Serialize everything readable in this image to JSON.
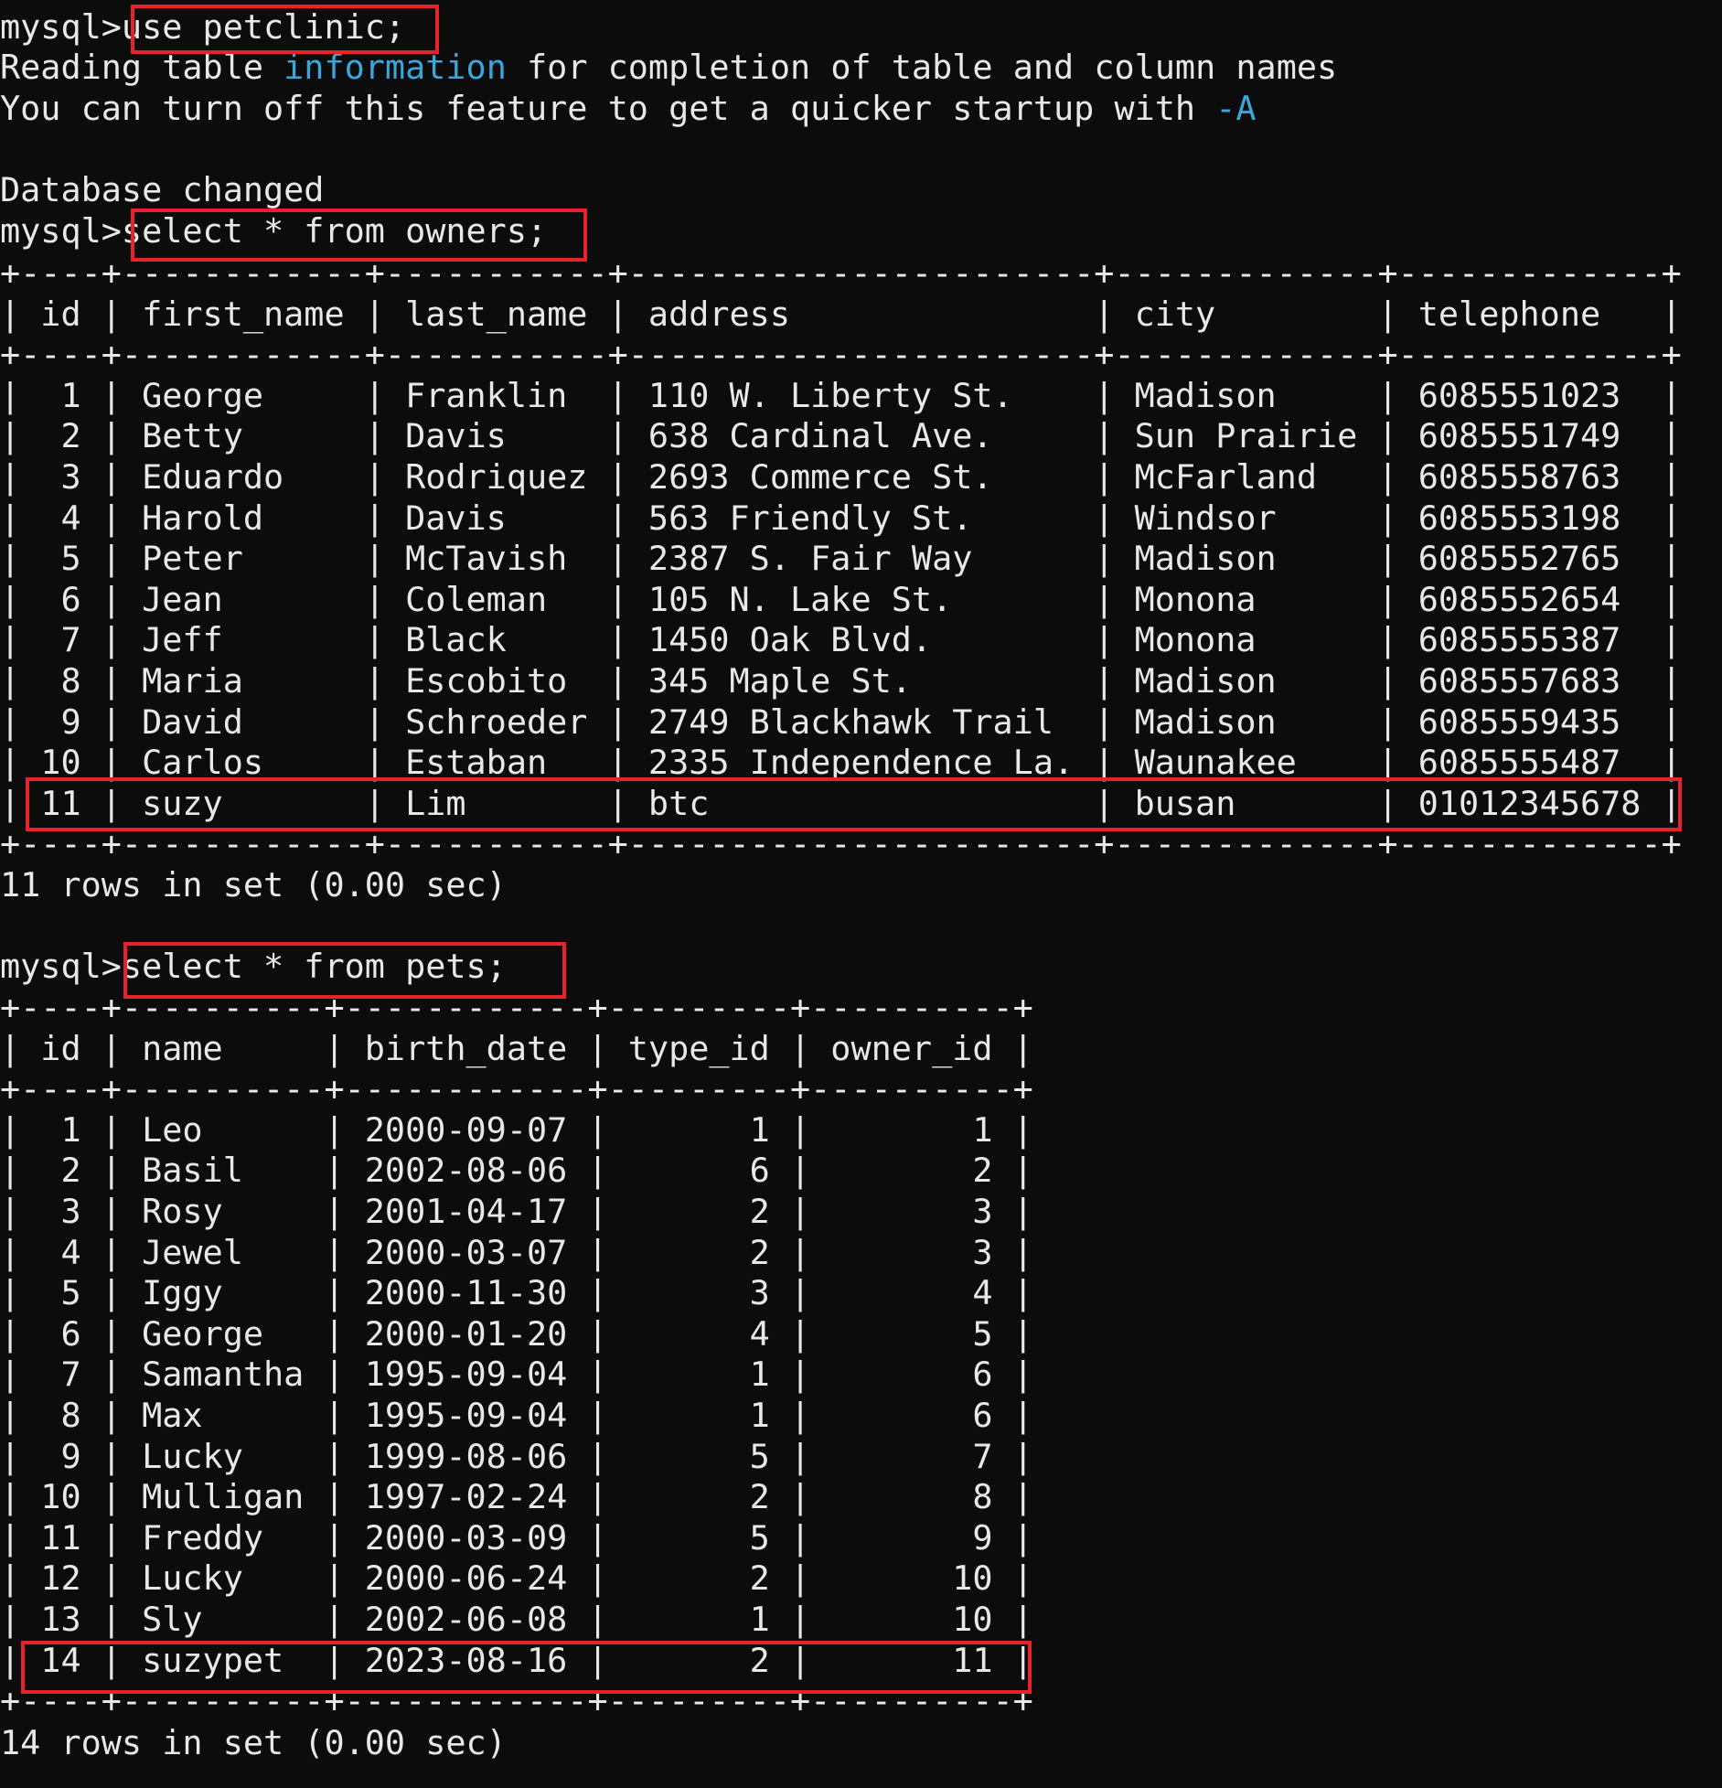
{
  "session": {
    "prompt": "mysql>",
    "commands": {
      "use": "use petclinic;",
      "owners": "select * from owners;",
      "pets": "select * from pets;"
    },
    "messages": {
      "reading_a": "Reading table ",
      "reading_b": "information",
      "reading_c": " for completion of table and column names",
      "turnoff_a": "You can turn off this feature to get a quicker startup with ",
      "turnoff_b": "-A",
      "db_changed": "Database changed"
    }
  },
  "owners_table": {
    "columns": [
      "id",
      "first_name",
      "last_name",
      "address",
      "city",
      "telephone"
    ],
    "rows": [
      [
        "1",
        "George",
        "Franklin",
        "110 W. Liberty St.",
        "Madison",
        "6085551023"
      ],
      [
        "2",
        "Betty",
        "Davis",
        "638 Cardinal Ave.",
        "Sun Prairie",
        "6085551749"
      ],
      [
        "3",
        "Eduardo",
        "Rodriquez",
        "2693 Commerce St.",
        "McFarland",
        "6085558763"
      ],
      [
        "4",
        "Harold",
        "Davis",
        "563 Friendly St.",
        "Windsor",
        "6085553198"
      ],
      [
        "5",
        "Peter",
        "McTavish",
        "2387 S. Fair Way",
        "Madison",
        "6085552765"
      ],
      [
        "6",
        "Jean",
        "Coleman",
        "105 N. Lake St.",
        "Monona",
        "6085552654"
      ],
      [
        "7",
        "Jeff",
        "Black",
        "1450 Oak Blvd.",
        "Monona",
        "6085555387"
      ],
      [
        "8",
        "Maria",
        "Escobito",
        "345 Maple St.",
        "Madison",
        "6085557683"
      ],
      [
        "9",
        "David",
        "Schroeder",
        "2749 Blackhawk Trail",
        "Madison",
        "6085559435"
      ],
      [
        "10",
        "Carlos",
        "Estaban",
        "2335 Independence La.",
        "Waunakee",
        "6085555487"
      ],
      [
        "11",
        "suzy",
        "Lim",
        "btc",
        "busan",
        "01012345678"
      ]
    ],
    "footer": "11 rows in set (0.00 sec)"
  },
  "pets_table": {
    "columns": [
      "id",
      "name",
      "birth_date",
      "type_id",
      "owner_id"
    ],
    "rows": [
      [
        "1",
        "Leo",
        "2000-09-07",
        "1",
        "1"
      ],
      [
        "2",
        "Basil",
        "2002-08-06",
        "6",
        "2"
      ],
      [
        "3",
        "Rosy",
        "2001-04-17",
        "2",
        "3"
      ],
      [
        "4",
        "Jewel",
        "2000-03-07",
        "2",
        "3"
      ],
      [
        "5",
        "Iggy",
        "2000-11-30",
        "3",
        "4"
      ],
      [
        "6",
        "George",
        "2000-01-20",
        "4",
        "5"
      ],
      [
        "7",
        "Samantha",
        "1995-09-04",
        "1",
        "6"
      ],
      [
        "8",
        "Max",
        "1995-09-04",
        "1",
        "6"
      ],
      [
        "9",
        "Lucky",
        "1999-08-06",
        "5",
        "7"
      ],
      [
        "10",
        "Mulligan",
        "1997-02-24",
        "2",
        "8"
      ],
      [
        "11",
        "Freddy",
        "2000-03-09",
        "5",
        "9"
      ],
      [
        "12",
        "Lucky",
        "2000-06-24",
        "2",
        "10"
      ],
      [
        "13",
        "Sly",
        "2002-06-08",
        "1",
        "10"
      ],
      [
        "14",
        "suzypet",
        "2023-08-16",
        "2",
        "11"
      ]
    ],
    "footer": "14 rows in set (0.00 sec)"
  },
  "colors": {
    "background": "#0c0c0c",
    "text": "#e8e8e8",
    "cyan_keyword": "#3aa6db",
    "highlight_box": "#e8222a"
  }
}
